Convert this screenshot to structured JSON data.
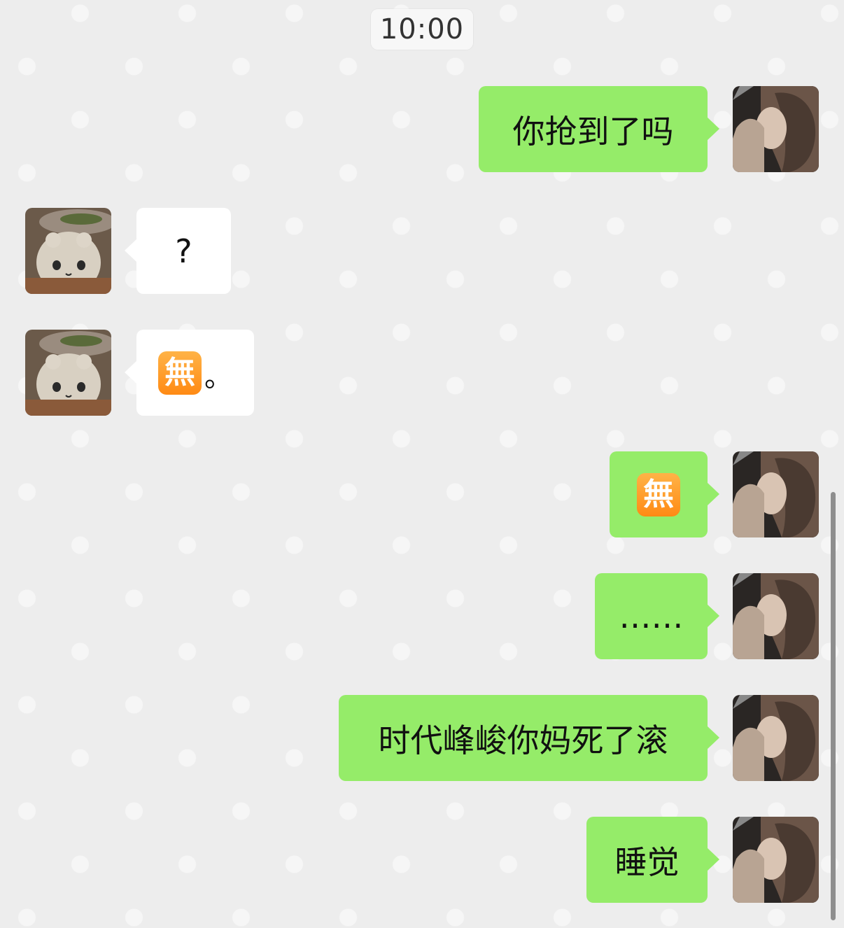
{
  "chat": {
    "timestamp": "10:00",
    "messages": [
      {
        "sender": "me",
        "text": "你抢到了吗"
      },
      {
        "sender": "them",
        "text": "?"
      },
      {
        "sender": "them",
        "emoji": "無",
        "suffix": "。"
      },
      {
        "sender": "me",
        "emoji": "無"
      },
      {
        "sender": "me",
        "text": "……"
      },
      {
        "sender": "me",
        "text": "时代峰峻你妈死了滚"
      },
      {
        "sender": "me",
        "text": "睡觉"
      }
    ]
  },
  "colors": {
    "background": "#ededed",
    "my_bubble": "#95ec69",
    "their_bubble": "#ffffff",
    "emoji_orange": "#ff8a14"
  },
  "icons": {
    "my_avatar": "girl-photo-avatar",
    "their_avatar": "plush-toy-avatar",
    "mu_emoji": "japanese-free-of-charge-button-emoji"
  }
}
